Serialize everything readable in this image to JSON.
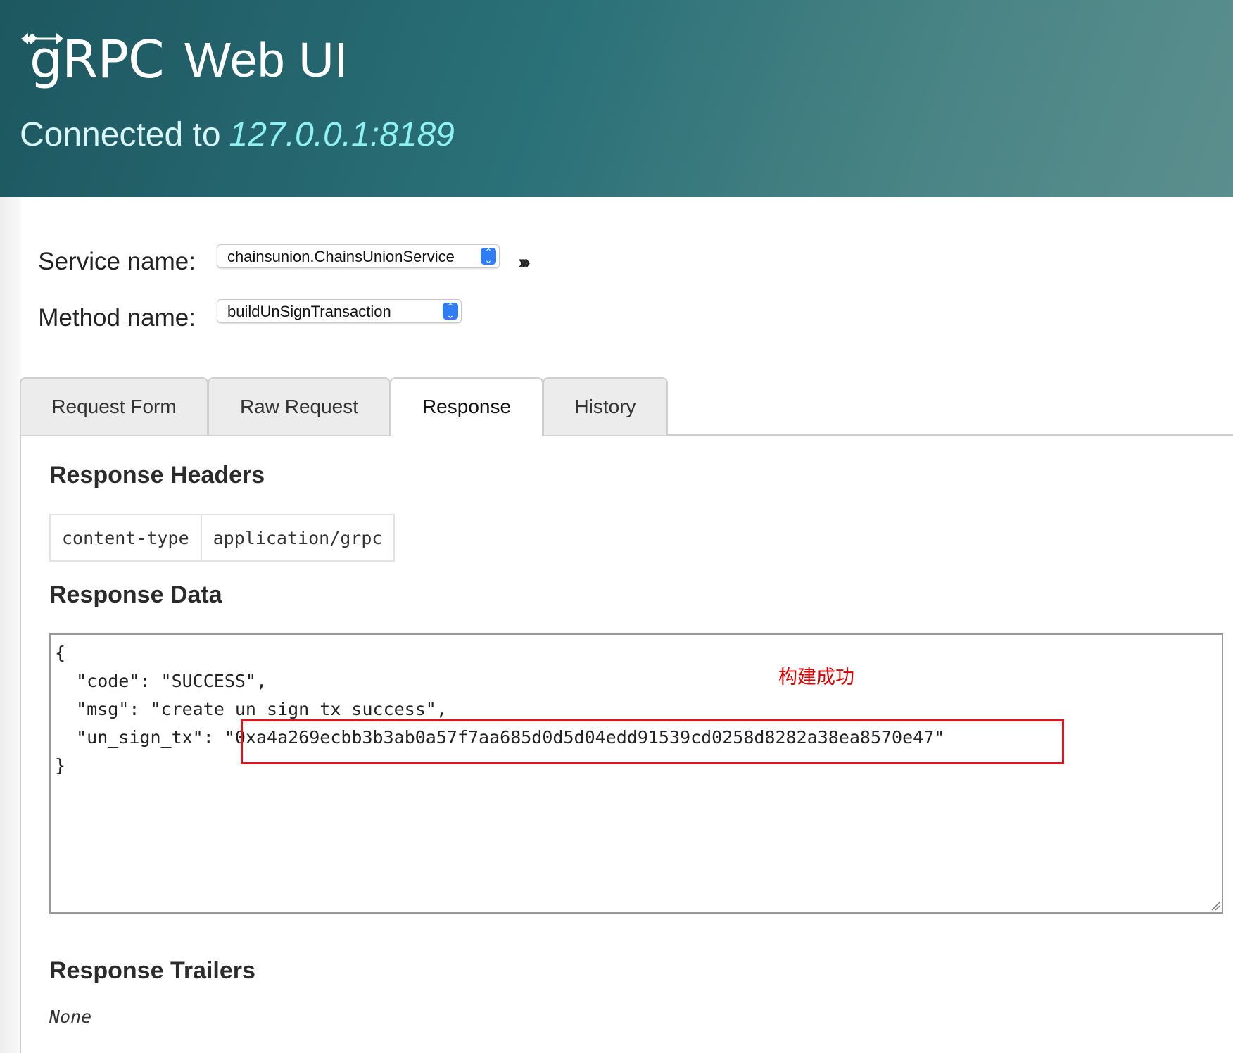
{
  "header": {
    "logo_text": "gRPC",
    "title": "Web UI",
    "connected_label": "Connected to",
    "address": "127.0.0.1:8189"
  },
  "service": {
    "label": "Service name:",
    "value": "chainsunion.ChainsUnionService"
  },
  "method": {
    "label": "Method name:",
    "value": "buildUnSignTransaction"
  },
  "expand_icon": "double-chevron-right-icon",
  "tabs": [
    {
      "label": "Request Form",
      "active": false
    },
    {
      "label": "Raw Request",
      "active": false
    },
    {
      "label": "Response",
      "active": true
    },
    {
      "label": "History",
      "active": false
    }
  ],
  "response": {
    "headers_title": "Response Headers",
    "headers": [
      {
        "name": "content-type",
        "value": "application/grpc"
      }
    ],
    "data_title": "Response Data",
    "data_lines": [
      "{",
      "  \"code\": \"SUCCESS\",",
      "  \"msg\": \"create un sign tx success\",",
      "  \"un_sign_tx\": \"0xa4a269ecbb3b3ab0a57f7aa685d0d5d04edd91539cd0258d8282a38ea8570e47\"",
      "}"
    ],
    "trailers_title": "Response Trailers",
    "trailers_value": "None"
  },
  "annotation": {
    "note": "构建成功",
    "color": "#e0141e"
  },
  "colors": {
    "header_gradient_start": "#1d5760",
    "header_gradient_end": "#5b8f8e",
    "address": "#8ff3f3",
    "select_accent": "#2f7cf6"
  }
}
